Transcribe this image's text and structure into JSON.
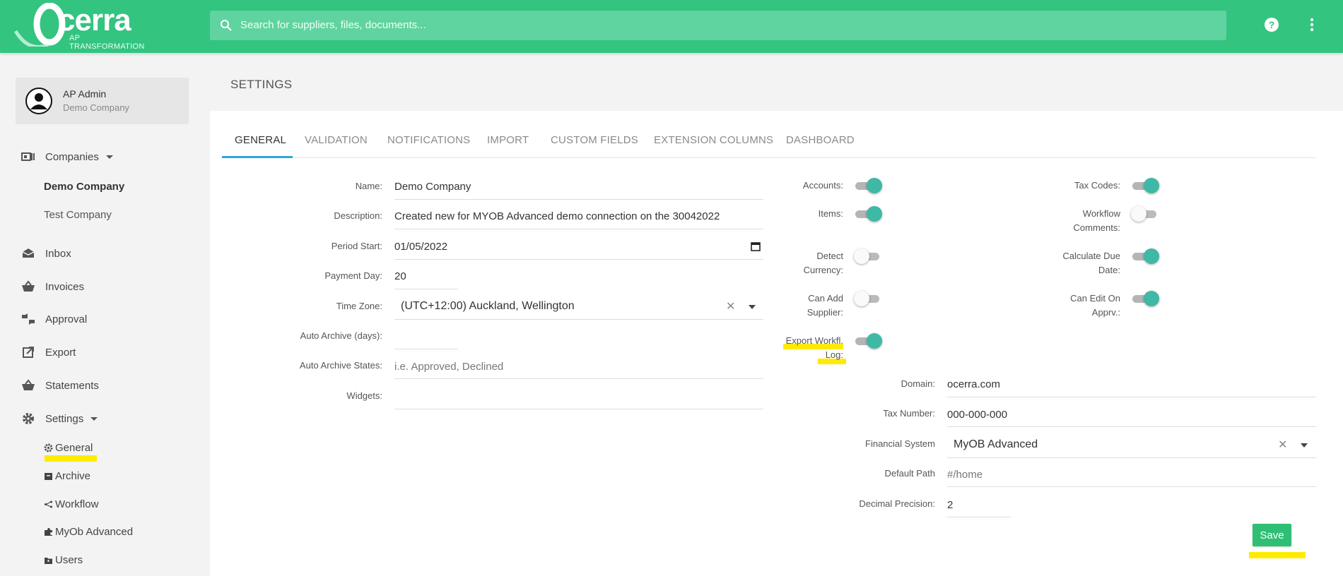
{
  "header": {
    "logo_text": "cerra",
    "logo_subtitle": "AP TRANSFORMATION",
    "search_placeholder": "Search for suppliers, files, documents..."
  },
  "profile": {
    "name": "AP Admin",
    "company": "Demo Company"
  },
  "sidebar": {
    "companies_label": "Companies",
    "companies": [
      {
        "label": "Demo Company",
        "active": true
      },
      {
        "label": "Test Company",
        "active": false
      }
    ],
    "items": [
      {
        "label": "Inbox",
        "icon": "inbox-icon"
      },
      {
        "label": "Invoices",
        "icon": "basket-icon"
      },
      {
        "label": "Approval",
        "icon": "thumbs-icon"
      },
      {
        "label": "Export",
        "icon": "export-icon"
      },
      {
        "label": "Statements",
        "icon": "basket-icon"
      }
    ],
    "settings_label": "Settings",
    "settings_items": [
      {
        "label": "General",
        "icon": "gear-icon"
      },
      {
        "label": "Archive",
        "icon": "archive-icon"
      },
      {
        "label": "Workflow",
        "icon": "workflow-icon"
      },
      {
        "label": "MyOb Advanced",
        "icon": "puzzle-icon"
      },
      {
        "label": "Users",
        "icon": "users-folder-icon"
      }
    ]
  },
  "page": {
    "title": "SETTINGS"
  },
  "tabs": [
    "GENERAL",
    "VALIDATION",
    "NOTIFICATIONS",
    "IMPORT",
    "CUSTOM FIELDS",
    "EXTENSION COLUMNS",
    "DASHBOARD"
  ],
  "form": {
    "name": {
      "label": "Name:",
      "value": "Demo Company"
    },
    "description": {
      "label": "Description:",
      "value": "Created new for MYOB Advanced demo connection on the 30042022"
    },
    "period_start": {
      "label": "Period Start:",
      "value": "01/05/2022"
    },
    "payment_day": {
      "label": "Payment Day:",
      "value": "20"
    },
    "time_zone": {
      "label": "Time Zone:",
      "value": "(UTC+12:00) Auckland, Wellington"
    },
    "auto_archive_days": {
      "label": "Auto Archive (days):",
      "value": ""
    },
    "auto_archive_states": {
      "label": "Auto Archive States:",
      "placeholder": "i.e. Approved, Declined"
    },
    "widgets": {
      "label": "Widgets:",
      "value": ""
    }
  },
  "toggles": {
    "accounts": {
      "label": "Accounts:",
      "on": true
    },
    "items": {
      "label": "Items:",
      "on": true
    },
    "detect_currency": {
      "label1": "Detect",
      "label2": "Currency:",
      "on": false
    },
    "can_add_supplier": {
      "label1": "Can Add",
      "label2": "Supplier:",
      "on": false
    },
    "export_workfl_log": {
      "label1": "Export Workfl.",
      "label2": "Log:",
      "on": true
    },
    "tax_codes": {
      "label": "Tax Codes:",
      "on": true
    },
    "workflow_comments": {
      "label1": "Workflow",
      "label2": "Comments:",
      "on": false
    },
    "calculate_due_date": {
      "label1": "Calculate Due",
      "label2": "Date:",
      "on": true
    },
    "can_edit_on_apprv": {
      "label1": "Can Edit On",
      "label2": "Apprv.:",
      "on": true
    }
  },
  "form2": {
    "domain": {
      "label": "Domain:",
      "value": "ocerra.com"
    },
    "tax_number": {
      "label": "Tax Number:",
      "value": "000-000-000"
    },
    "financial_system": {
      "label": "Financial System",
      "value": "MyOB Advanced"
    },
    "default_path": {
      "label": "Default Path",
      "value": "#/home"
    },
    "decimal_precision": {
      "label": "Decimal Precision:",
      "value": "2"
    }
  },
  "actions": {
    "save_label": "Save"
  },
  "colors": {
    "brand_green": "#33c480",
    "toggle_on": "#3fb8a6",
    "tab_active": "#2ea5e0",
    "highlight": "#ffeb00",
    "save_button": "#2fbf74"
  }
}
